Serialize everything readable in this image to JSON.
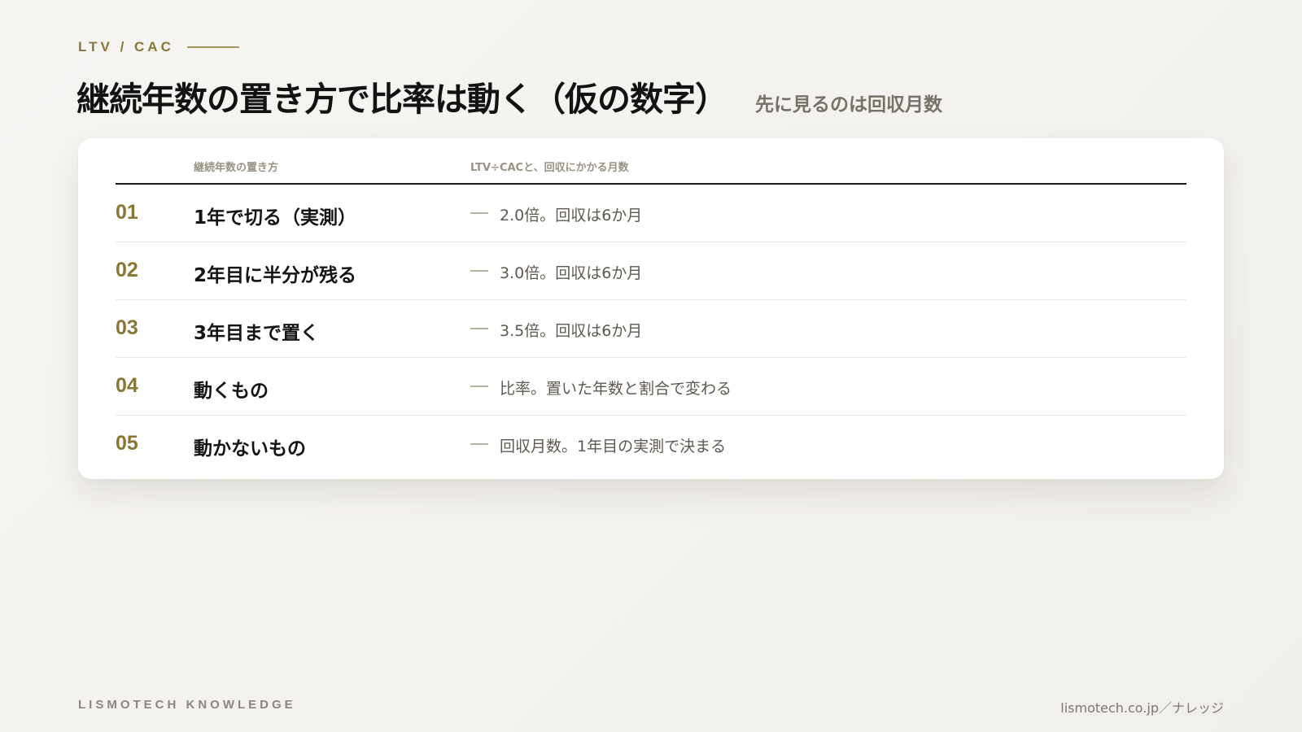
{
  "header": {
    "eyebrow": "LTV / CAC",
    "title": "継続年数の置き方で比率は動く（仮の数字）",
    "subtitle": "先に見るのは回収月数"
  },
  "table": {
    "col_method": "継続年数の置き方",
    "col_result": "LTV÷CACと、回収にかかる月数",
    "rows": [
      {
        "num": "01",
        "method": "1年で切る（実測）",
        "result": "2.0倍。回収は6か月"
      },
      {
        "num": "02",
        "method": "2年目に半分が残る",
        "result": "3.0倍。回収は6か月"
      },
      {
        "num": "03",
        "method": "3年目まで置く",
        "result": "3.5倍。回収は6か月"
      },
      {
        "num": "04",
        "method": "動くもの",
        "result": "比率。置いた年数と割合で変わる"
      },
      {
        "num": "05",
        "method": "動かないもの",
        "result": "回収月数。1年目の実測で決まる"
      }
    ]
  },
  "footer": {
    "brand": "LISMOTECH KNOWLEDGE",
    "url": "lismotech.co.jp／ナレッジ"
  },
  "colors": {
    "accent": "#8a7634",
    "title": "#121212",
    "muted": "#777268",
    "background": "#f4f3ef"
  }
}
